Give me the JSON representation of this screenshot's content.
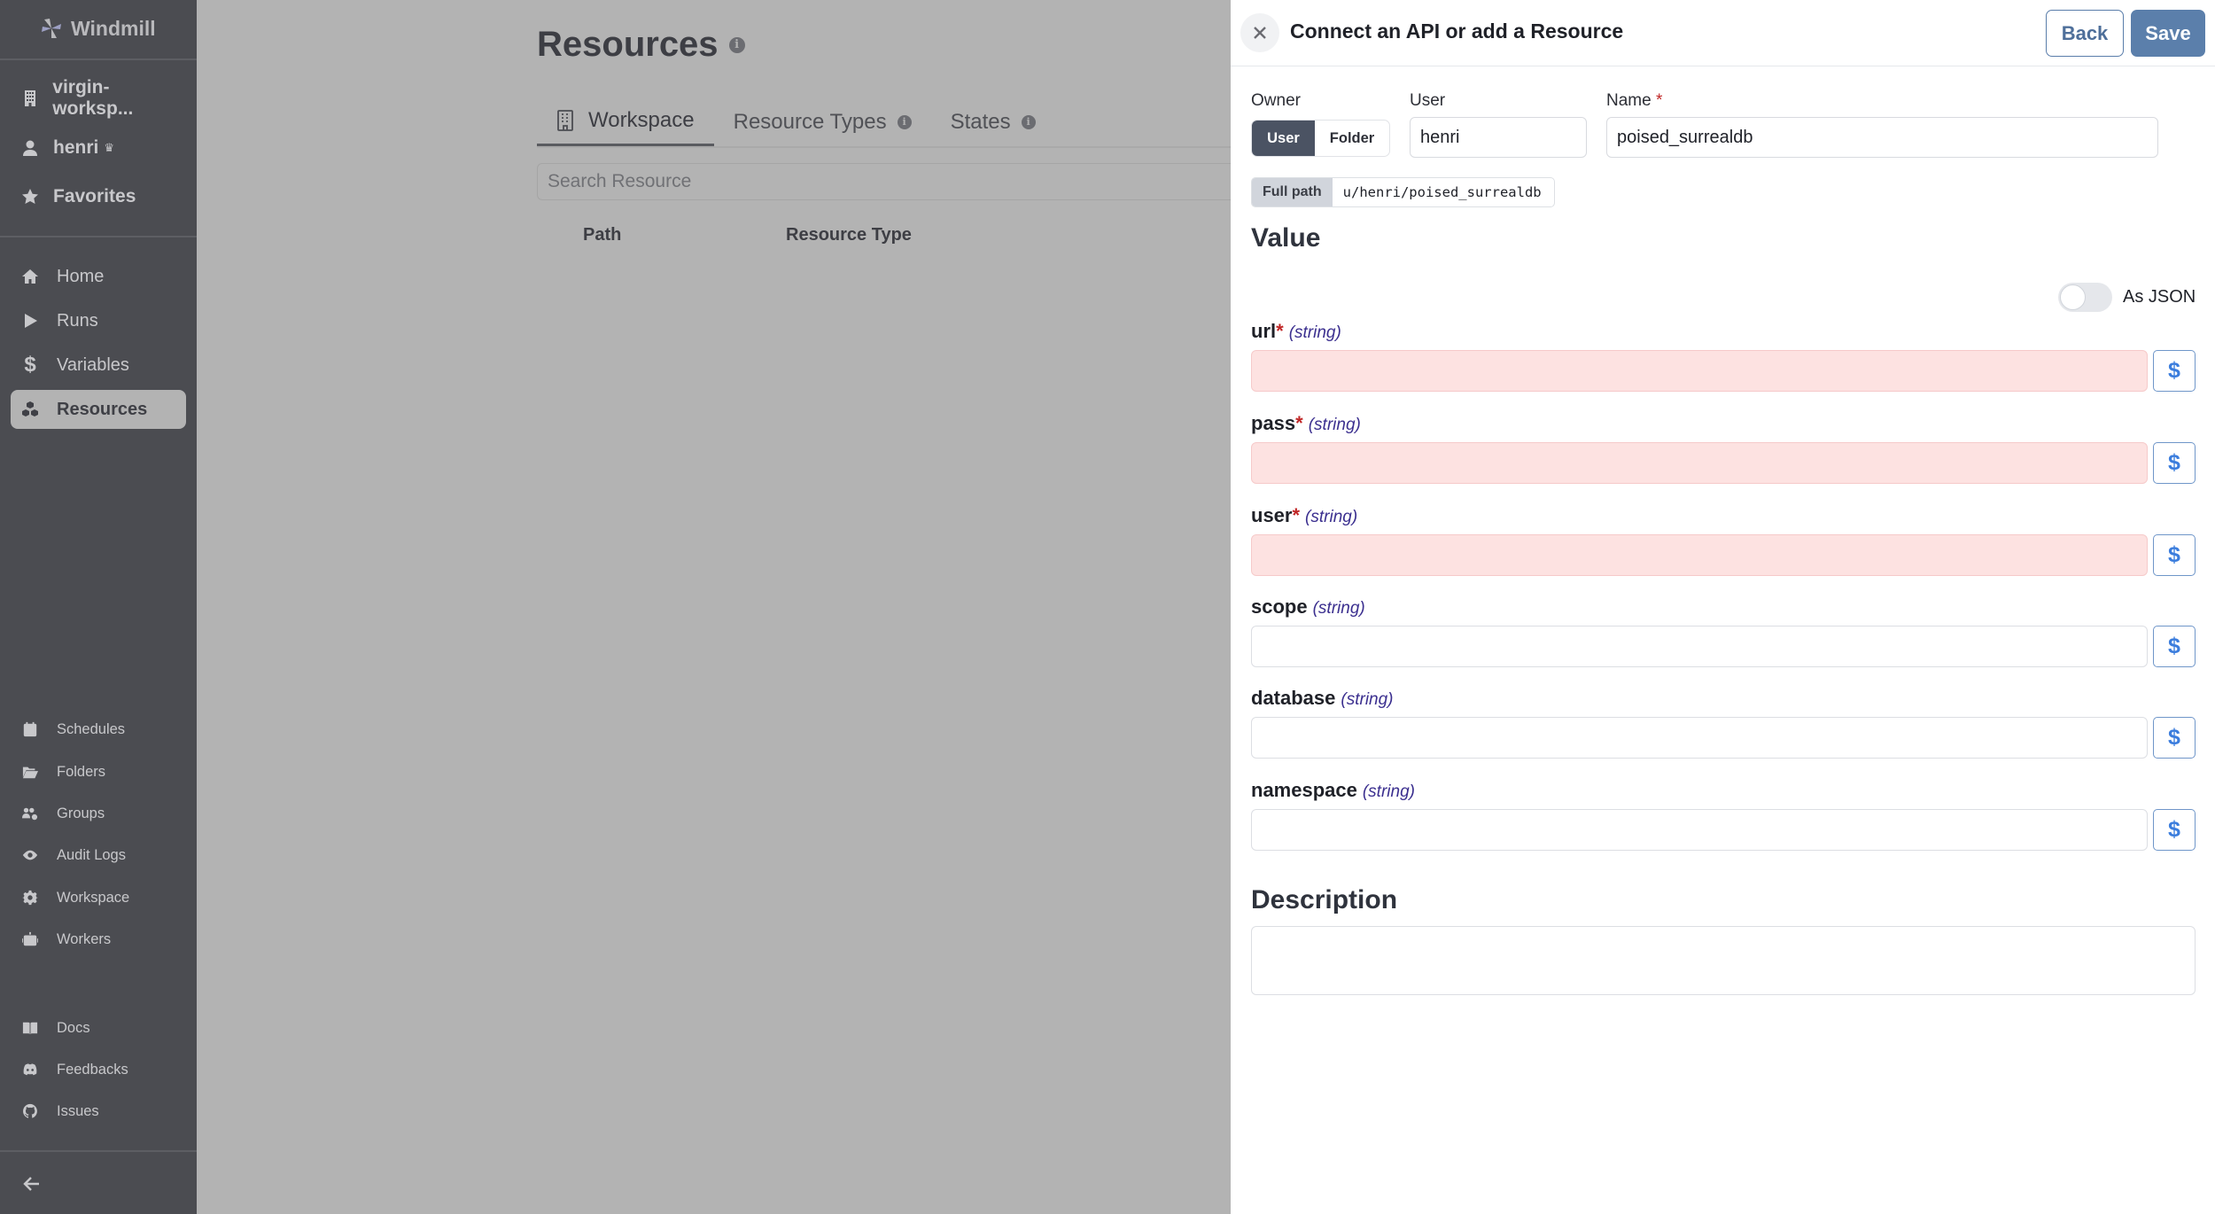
{
  "app": {
    "logo_text": "Windmill"
  },
  "sidebar": {
    "workspace": "virgin-worksp...",
    "user": "henri",
    "favorites": "Favorites",
    "main_items": [
      {
        "label": "Home",
        "icon": "home-icon"
      },
      {
        "label": "Runs",
        "icon": "play-icon"
      },
      {
        "label": "Variables",
        "icon": "dollar-icon"
      },
      {
        "label": "Resources",
        "icon": "cubes-icon",
        "active": true
      }
    ],
    "secondary_items": [
      {
        "label": "Schedules",
        "icon": "calendar-icon"
      },
      {
        "label": "Folders",
        "icon": "folder-open-icon"
      },
      {
        "label": "Groups",
        "icon": "users-gear-icon"
      },
      {
        "label": "Audit Logs",
        "icon": "eye-icon"
      },
      {
        "label": "Workspace",
        "icon": "gear-icon"
      },
      {
        "label": "Workers",
        "icon": "robot-icon"
      }
    ],
    "help_items": [
      {
        "label": "Docs",
        "icon": "book-icon"
      },
      {
        "label": "Feedbacks",
        "icon": "discord-icon"
      },
      {
        "label": "Issues",
        "icon": "github-icon"
      }
    ]
  },
  "page": {
    "title": "Resources",
    "tabs": [
      {
        "label": "Workspace",
        "active": true
      },
      {
        "label": "Resource Types",
        "info": true
      },
      {
        "label": "States",
        "info": true
      }
    ],
    "search_placeholder": "Search Resource",
    "table_headers": [
      "Path",
      "Resource Type"
    ]
  },
  "drawer": {
    "title": "Connect an API or add a Resource",
    "back_label": "Back",
    "save_label": "Save",
    "owner_label": "Owner",
    "owner_options": [
      "User",
      "Folder"
    ],
    "owner_selected": "User",
    "user_label": "User",
    "user_value": "henri",
    "name_label": "Name",
    "name_required": "*",
    "name_value": "poised_surrealdb",
    "full_path_label": "Full path",
    "full_path_value": "u/henri/poised_surrealdb",
    "value_heading": "Value",
    "as_json_label": "As JSON",
    "as_json_enabled": false,
    "fields": [
      {
        "name": "url",
        "required": true,
        "type": "(string)",
        "value": ""
      },
      {
        "name": "pass",
        "required": true,
        "type": "(string)",
        "value": ""
      },
      {
        "name": "user",
        "required": true,
        "type": "(string)",
        "value": ""
      },
      {
        "name": "scope",
        "required": false,
        "type": "(string)",
        "value": ""
      },
      {
        "name": "database",
        "required": false,
        "type": "(string)",
        "value": ""
      },
      {
        "name": "namespace",
        "required": false,
        "type": "(string)",
        "value": ""
      }
    ],
    "dollar_button_label": "$",
    "description_heading": "Description",
    "description_value": ""
  },
  "colors": {
    "sidebar_bg": "#4b4c51",
    "overlay_bg": "#b3b3b3",
    "accent": "#5b7fab",
    "required": "#c02626",
    "invalid_input_bg": "#fde2e1",
    "type_hint": "#3b2f8f"
  }
}
